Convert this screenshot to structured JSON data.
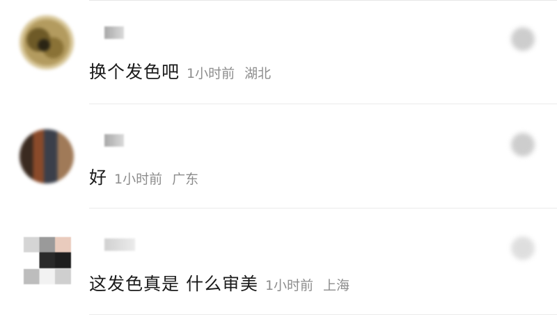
{
  "comments": [
    {
      "text": "换个发色吧",
      "time": "1小时前",
      "location": "湖北"
    },
    {
      "text": "好",
      "time": "1小时前",
      "location": "广东"
    },
    {
      "text": "这发色真是 什么审美",
      "time": "1小时前",
      "location": "上海"
    }
  ]
}
